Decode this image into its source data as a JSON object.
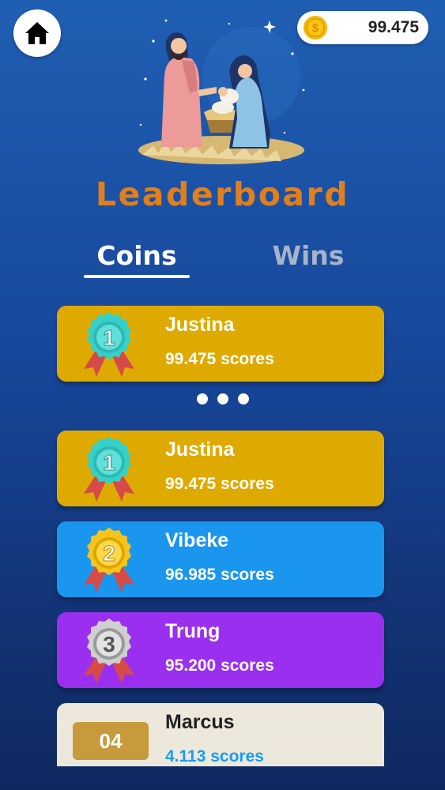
{
  "header": {
    "coin_balance": "99.475",
    "home_icon": "home-icon",
    "coin_icon": "coin-icon"
  },
  "title": "Leaderboard",
  "tabs": [
    {
      "label": "Coins",
      "active": true
    },
    {
      "label": "Wins",
      "active": false
    }
  ],
  "current_user": {
    "rank": "1",
    "name": "Justina",
    "score": "99.475 scores",
    "color": "#deaa00"
  },
  "leaderboard": [
    {
      "rank": "1",
      "name": "Justina",
      "score": "99.475 scores",
      "color": "#deaa00",
      "medal": "teal"
    },
    {
      "rank": "2",
      "name": "Vibeke",
      "score": "96.985 scores",
      "color": "#1b96ef",
      "medal": "gold"
    },
    {
      "rank": "3",
      "name": "Trung",
      "score": "95.200 scores",
      "color": "#9b2ff0",
      "medal": "silver"
    },
    {
      "rank": "04",
      "name": "Marcus",
      "score": "4.113 scores",
      "color": "#ede8dc"
    }
  ],
  "colors": {
    "title": "#e07f1e",
    "gold_card": "#deaa00",
    "blue_card": "#1b96ef",
    "purple_card": "#9b2ff0",
    "light_card": "#ede8dc",
    "rank_box": "#c79b3c"
  }
}
